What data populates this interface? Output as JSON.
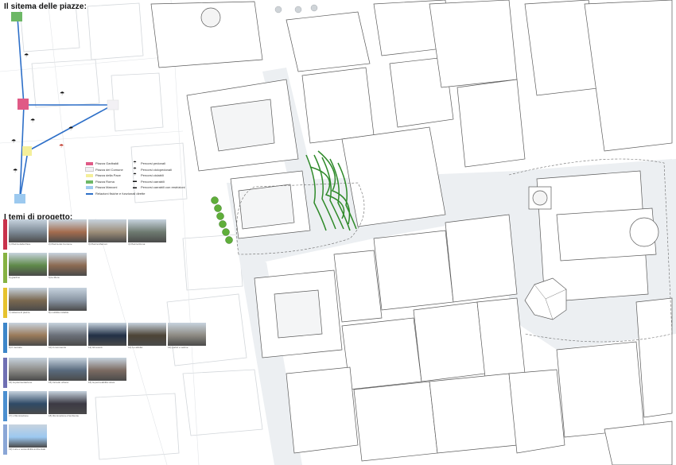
{
  "schema": {
    "title": "Il sitema delle piazze:",
    "legend_piazze": [
      {
        "label": "Piazza Garibaldi",
        "color": "#e05a86"
      },
      {
        "label": "Piazza del Comune",
        "color": "#f2f0f4"
      },
      {
        "label": "Piazza della Pace",
        "color": "#f4ef9a"
      },
      {
        "label": "Piazza Roma",
        "color": "#6db866"
      },
      {
        "label": "Piazza Marconi",
        "color": "#9cc9ef"
      },
      {
        "label": "Relazioni fisiche e funzionali dirette",
        "color": "#2d6fc8"
      }
    ],
    "legend_percorsi": [
      {
        "label": "Percorsi pedonali",
        "icon": "pedestrian-icon"
      },
      {
        "label": "Percorsi ciclopedonali",
        "icon": "cyclist-pedestrian-icon"
      },
      {
        "label": "Percorsi ciclabili",
        "icon": "bicycle-icon"
      },
      {
        "label": "Percorsi carrabili",
        "icon": "car-icon"
      },
      {
        "label": "Percorsi carrabili con restrizioni",
        "icon": "restricted-car-icon"
      }
    ]
  },
  "themes": {
    "title": "I temi di progetto:",
    "rows": [
      {
        "color": "#c8324b",
        "captions": [
          "1) Piazza della Pace",
          "2) Piazza del Comune",
          "3) Piazza Marconi",
          "4) Piazza Roma"
        ],
        "photos": [
          "#7d8a96",
          "#a46c4e",
          "#9c8d78",
          "#6e7a70"
        ]
      },
      {
        "color": "#86b242",
        "captions": [
          "5) giardino",
          "6) le Mura"
        ],
        "photos": [
          "#5f8a4a",
          "#8c6a52"
        ]
      },
      {
        "color": "#e6c22e",
        "captions": [
          "7) sistema di piazze",
          "8) mobilità ciclabile"
        ],
        "photos": [
          "#7a6850",
          "#8894a2"
        ]
      },
      {
        "color": "#3d86c9",
        "captions": [
          "9) Il mercato",
          "10) Il commercio",
          "11) Gli eventi",
          "12) Le attività",
          "13) portici e vetrine"
        ],
        "photos": [
          "#9a7a5a",
          "#6a6f78",
          "#223046",
          "#4d4436",
          "#8d8a82"
        ]
      },
      {
        "color": "#6f6fb3",
        "captions": [
          "14) la pavimentazione",
          "15) l'arredo urbano",
          "16) la permeabilità visiva"
        ],
        "photos": [
          "#8b8a86",
          "#5a6b7e",
          "#7c6b62"
        ]
      },
      {
        "color": "#4b8fd0",
        "captions": [
          "17) L'illuminazione",
          "18) Illuminazione d'ambiente"
        ],
        "photos": [
          "#2f4a66",
          "#3c3a44"
        ]
      },
      {
        "color": "#8aa6d6",
        "captions": [
          "19) Luce e sostenibilità ambientale"
        ],
        "photos": [
          "#9cc8f0"
        ]
      }
    ]
  },
  "colors": {
    "building_fill": "#ffffff",
    "building_stroke": "#555555",
    "block_fill": "#eceff2",
    "street": "#ffffff",
    "faded_building": "#d9dde1",
    "tree_green": "#5fae3a",
    "vegetation": "#2f8a2a",
    "route_blue": "#2d6fc8"
  }
}
